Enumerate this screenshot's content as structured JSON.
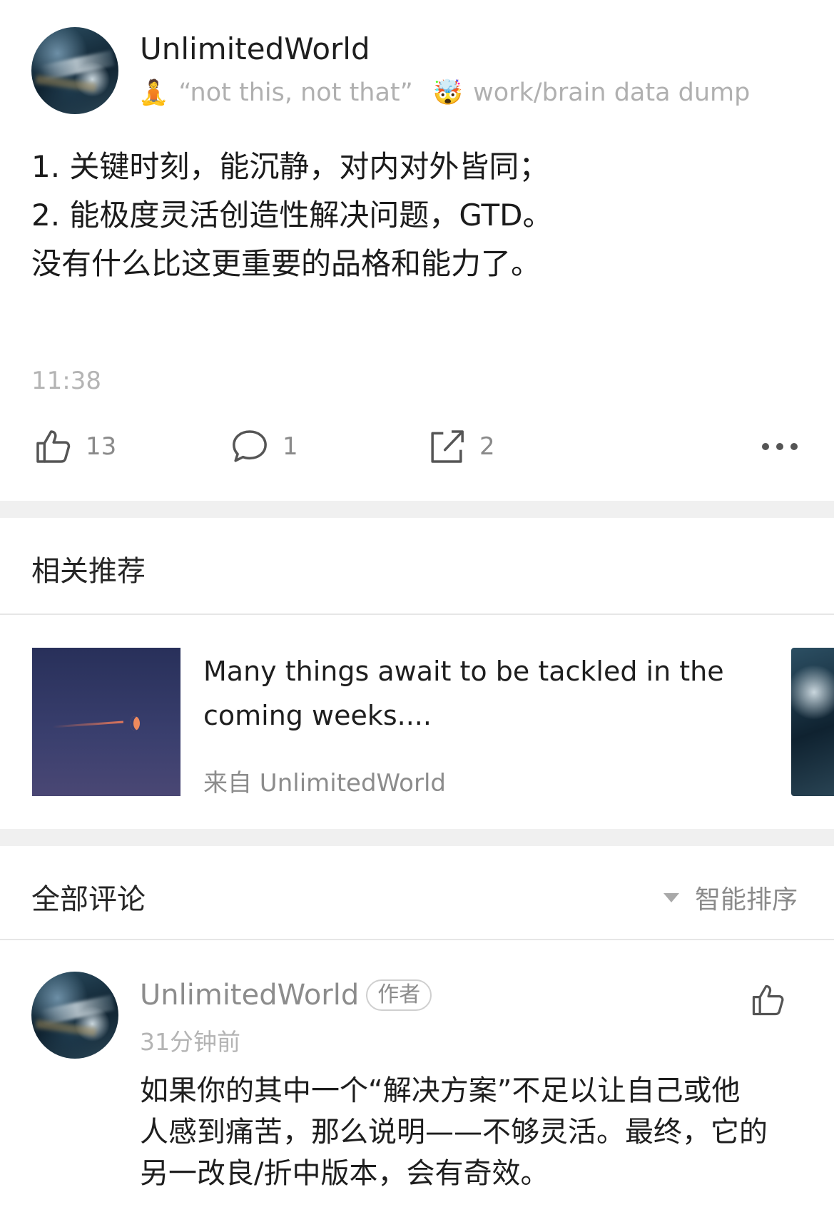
{
  "post": {
    "author_name": "UnlimitedWorld",
    "bio_emoji_1": "🧘",
    "bio_text_1": "“not this, not that”",
    "bio_emoji_2": "🤯",
    "bio_text_2": "work/brain data dump",
    "body_lines": [
      "1. 关键时刻，能沉静，对内对外皆同；",
      "2. 能极度灵活创造性解决问题，GTD。",
      "",
      "没有什么比这更重要的品格和能力了。"
    ],
    "time": "11:38",
    "like_count": "13",
    "comment_count": "1",
    "share_count": "2"
  },
  "recommendations": {
    "title": "相关推荐",
    "items": [
      {
        "title_lines": [
          "Many things await to be tackled in the",
          "coming weeks...."
        ],
        "source": "来自 UnlimitedWorld"
      }
    ]
  },
  "comments": {
    "title": "全部评论",
    "sort_label": "智能排序",
    "items": [
      {
        "author_name": "UnlimitedWorld",
        "badge": "作者",
        "time": "31分钟前",
        "text_lines": [
          "如果你的其中一个“解决方案”不足以让自己或他",
          "人感到痛苦，那么说明——不够灵活。最终，它的",
          "另一改良/折中版本，会有奇效。"
        ]
      }
    ]
  },
  "colors": {
    "separator": "#f0f0f0",
    "muted_text": "#8c8c8c",
    "light_text": "#b4b4b4",
    "primary_text": "#1e1e1e"
  },
  "icons": {
    "like": "thumbs-up-icon",
    "comment": "speech-bubble-icon",
    "share": "share-arrow-icon",
    "more": "more-horizontal-icon",
    "sort": "triangle-down-icon"
  }
}
